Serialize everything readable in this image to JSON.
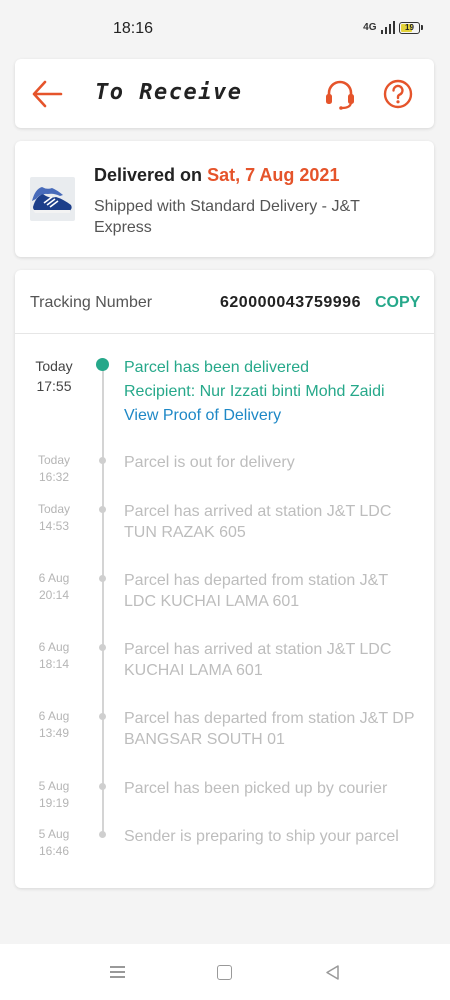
{
  "status_bar": {
    "time": "18:16",
    "network": "4G",
    "battery": "19"
  },
  "header": {
    "title": "To Receive"
  },
  "delivery": {
    "prefix": "Delivered on",
    "date": "Sat, 7 Aug 2021",
    "shipping": "Shipped with Standard Delivery  - J&T Express"
  },
  "tracking": {
    "label": "Tracking Number",
    "number": "620000043759996",
    "copy_label": "COPY"
  },
  "events": [
    {
      "day": "Today",
      "time": "17:55",
      "lines": [
        "Parcel has been delivered",
        "Recipient: Nur Izzati binti Mohd Zaidi"
      ],
      "link": "View Proof of Delivery"
    },
    {
      "day": "Today",
      "time": "16:32",
      "text": "Parcel is out for delivery"
    },
    {
      "day": "Today",
      "time": "14:53",
      "text": "Parcel has arrived at station J&T LDC TUN RAZAK 605"
    },
    {
      "day": "6 Aug",
      "time": "20:14",
      "text": "Parcel has departed from station J&T LDC KUCHAI LAMA 601"
    },
    {
      "day": "6 Aug",
      "time": "18:14",
      "text": "Parcel has arrived at station J&T LDC KUCHAI LAMA 601"
    },
    {
      "day": "6 Aug",
      "time": "13:49",
      "text": "Parcel has departed from station J&T DP BANGSAR SOUTH 01"
    },
    {
      "day": "5 Aug",
      "time": "19:19",
      "text": "Parcel has been picked up by courier"
    },
    {
      "day": "5 Aug",
      "time": "16:46",
      "text": "Sender is preparing to ship your parcel"
    }
  ],
  "colors": {
    "accent": "#e5542b",
    "delivered": "#26a88a",
    "link": "#1e88c6"
  },
  "icons": {
    "back": "arrow-left-icon",
    "support": "headset-icon",
    "help": "question-circle-icon",
    "nav_menu": "menu-icon",
    "nav_home": "square-home-icon",
    "nav_back": "triangle-back-icon"
  }
}
